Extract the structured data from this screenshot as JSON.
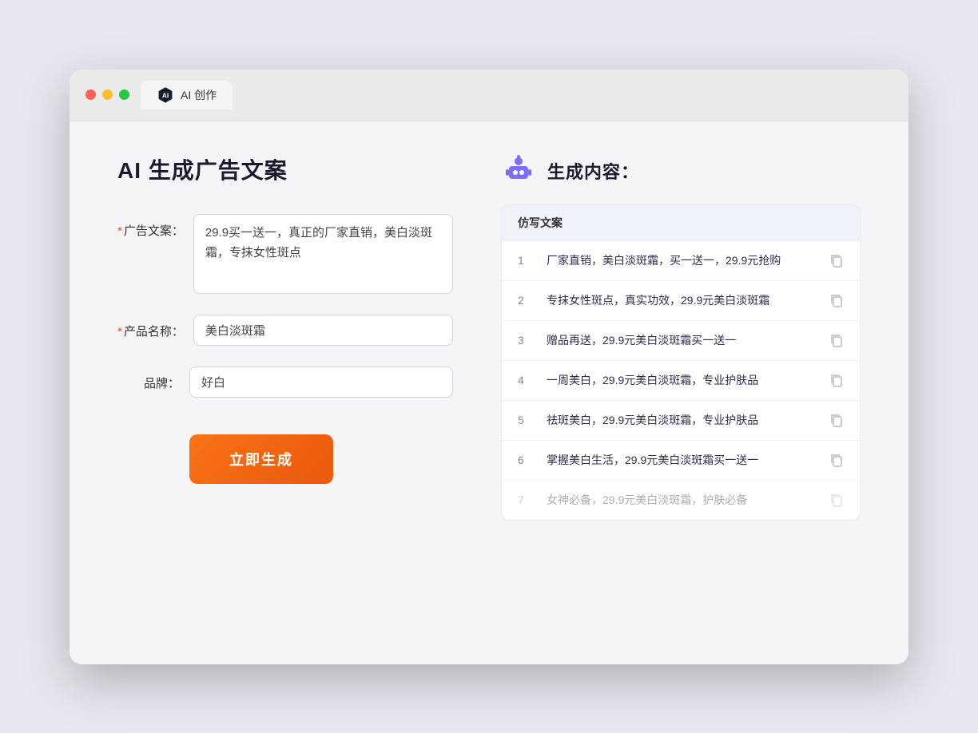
{
  "browser": {
    "tab_title": "AI 创作"
  },
  "page": {
    "title": "AI 生成广告文案",
    "form": {
      "ad_copy_label": "广告文案：",
      "ad_copy_required": "*",
      "ad_copy_value": "29.9买一送一，真正的厂家直销，美白淡斑霜，专抹女性斑点",
      "product_name_label": "产品名称：",
      "product_name_required": "*",
      "product_name_value": "美白淡斑霜",
      "brand_label": "品牌：",
      "brand_value": "好白",
      "generate_button": "立即生成"
    },
    "results": {
      "header_icon": "robot",
      "header_title": "生成内容：",
      "table_header": "仿写文案",
      "items": [
        {
          "num": "1",
          "text": "厂家直销，美白淡斑霜，买一送一，29.9元抢购"
        },
        {
          "num": "2",
          "text": "专抹女性斑点，真实功效，29.9元美白淡斑霜"
        },
        {
          "num": "3",
          "text": "赠品再送，29.9元美白淡斑霜买一送一"
        },
        {
          "num": "4",
          "text": "一周美白，29.9元美白淡斑霜，专业护肤品"
        },
        {
          "num": "5",
          "text": "祛斑美白，29.9元美白淡斑霜，专业护肤品"
        },
        {
          "num": "6",
          "text": "掌握美白生活，29.9元美白淡斑霜买一送一"
        },
        {
          "num": "7",
          "text": "女神必备，29.9元美白淡斑霜，护肤必备"
        }
      ]
    }
  }
}
